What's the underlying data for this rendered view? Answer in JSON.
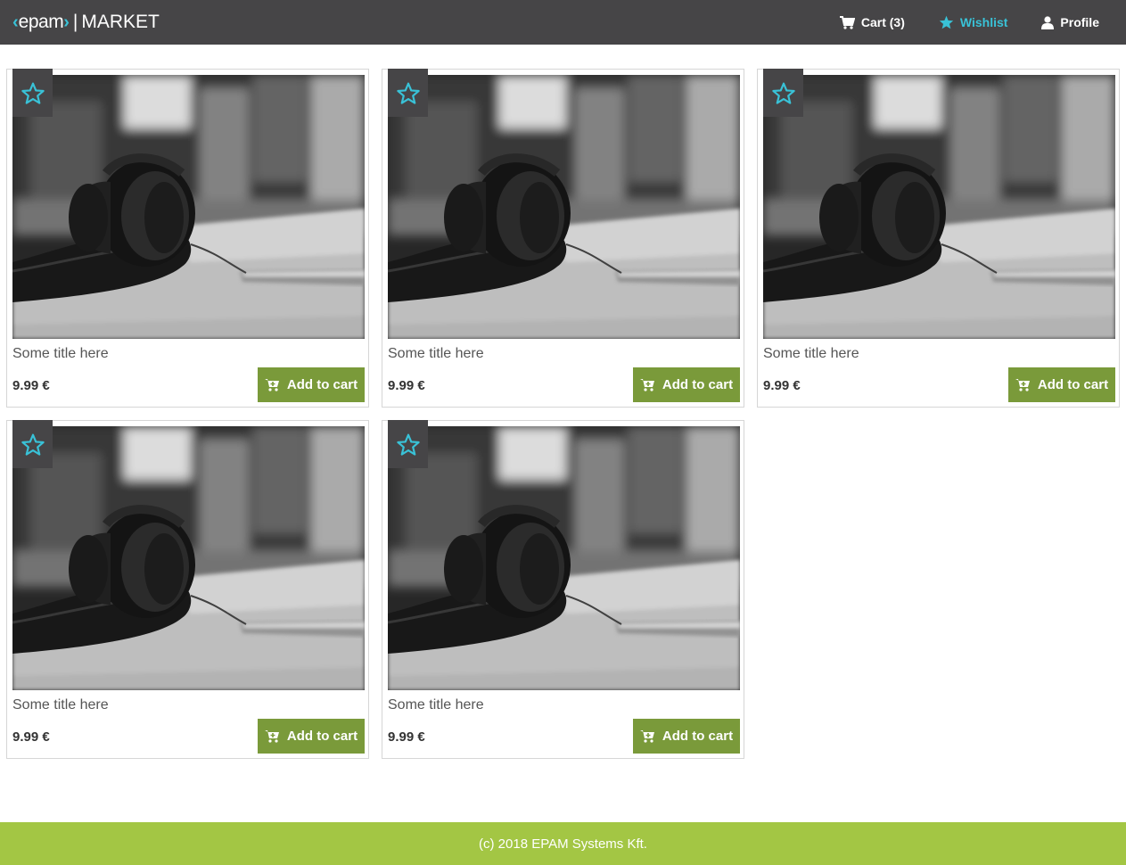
{
  "header": {
    "logo_text": "epam",
    "separator": "|",
    "app_title": "MARKET",
    "nav": {
      "cart_label": "Cart (3)",
      "wishlist_label": "Wishlist",
      "profile_label": "Profile"
    }
  },
  "colors": {
    "header_bg": "#464547",
    "accent": "#39c2d7",
    "add_button": "#7a9a3a",
    "footer_bg": "#a3c644"
  },
  "products": [
    {
      "title": "Some title here",
      "price": "9.99 €",
      "button_label": "Add to cart",
      "wishlist_icon": "star-outline-icon"
    },
    {
      "title": "Some title here",
      "price": "9.99 €",
      "button_label": "Add to cart",
      "wishlist_icon": "star-outline-icon"
    },
    {
      "title": "Some title here",
      "price": "9.99 €",
      "button_label": "Add to cart",
      "wishlist_icon": "star-outline-icon"
    },
    {
      "title": "Some title here",
      "price": "9.99 €",
      "button_label": "Add to cart",
      "wishlist_icon": "star-outline-icon"
    },
    {
      "title": "Some title here",
      "price": "9.99 €",
      "button_label": "Add to cart",
      "wishlist_icon": "star-outline-icon"
    }
  ],
  "footer": {
    "text": "(c) 2018 EPAM Systems Kft."
  }
}
